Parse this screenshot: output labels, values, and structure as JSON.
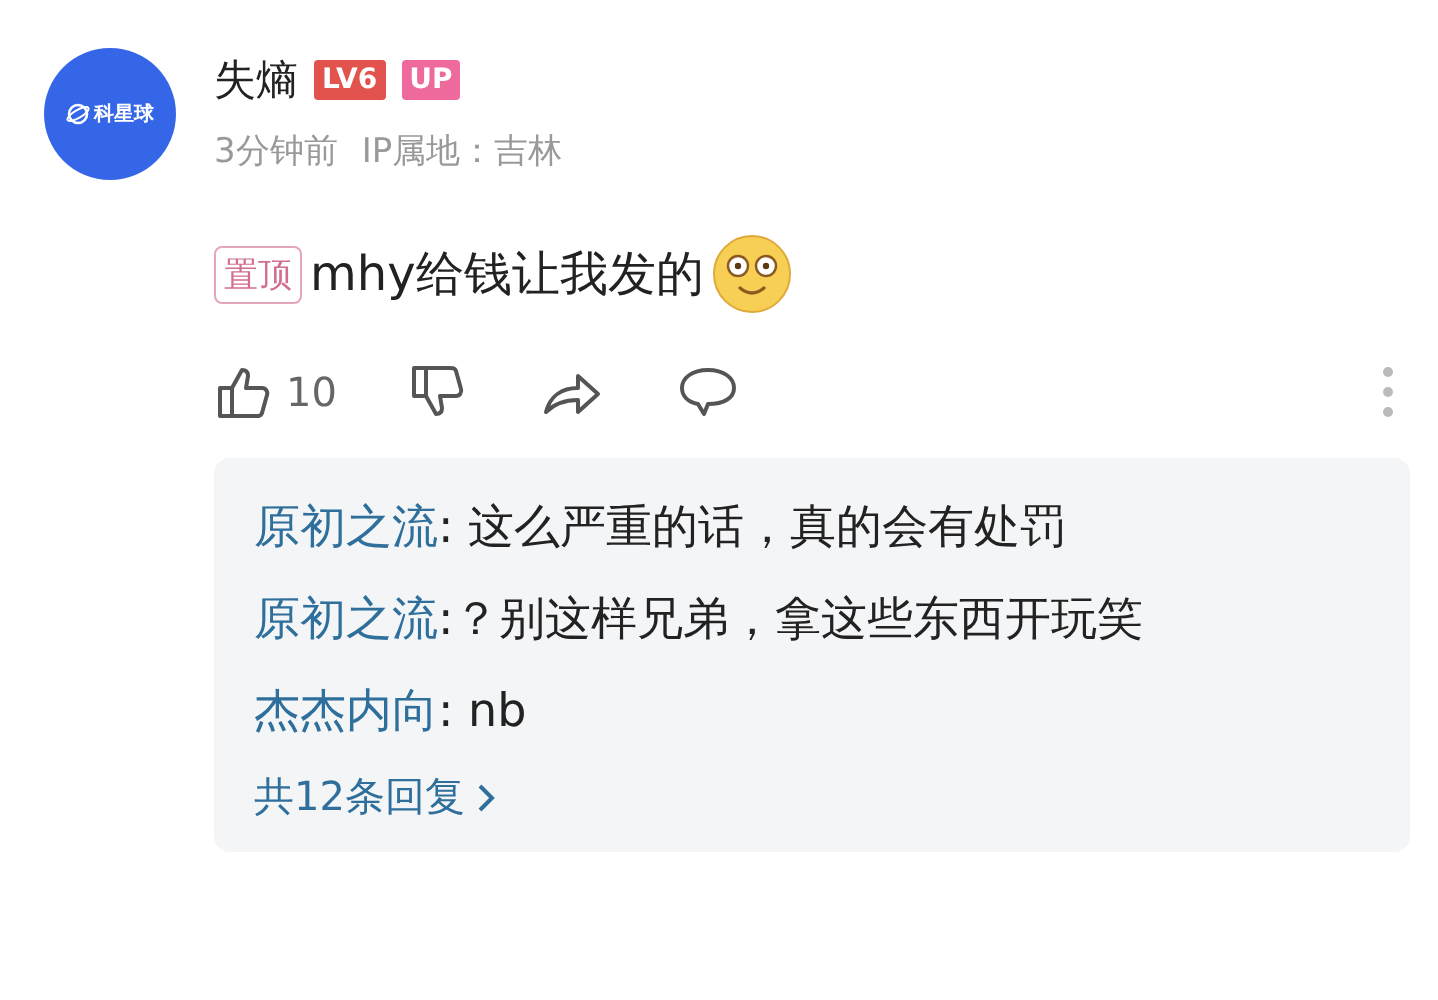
{
  "comment": {
    "avatar_label": "科星球",
    "author": "失熵",
    "badges": [
      {
        "kind": "level",
        "label": "LV6"
      },
      {
        "kind": "up",
        "label": "UP"
      }
    ],
    "time": "3分钟前",
    "location": "IP属地：吉林",
    "pin_label": "置顶",
    "text": "mhy给钱让我发的",
    "likes": "10"
  },
  "replies": [
    {
      "name": "原初之流",
      "text": ": 这么严重的话，真的会有处罚"
    },
    {
      "name": "原初之流",
      "text": ":？别这样兄弟，拿这些东西开玩笑"
    },
    {
      "name": "杰杰内向",
      "text": ": nb"
    }
  ],
  "more_replies": "共12条回复"
}
